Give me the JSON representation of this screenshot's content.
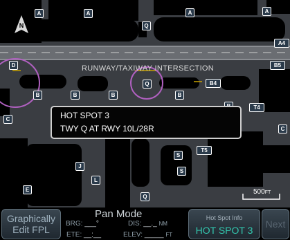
{
  "map": {
    "north_label": "N",
    "intersection_label": "RUNWAY/TAXIWAY INTERSECTION",
    "taxiway_labels": [
      "A",
      "B",
      "C",
      "D",
      "E",
      "J",
      "L",
      "Q",
      "S",
      "T4",
      "T5",
      "B4",
      "B5",
      "A4"
    ],
    "scale": {
      "value": "500",
      "unit": "FT"
    }
  },
  "popup": {
    "title": "HOT SPOT 3",
    "detail": "TWY Q AT RWY 10L/28R"
  },
  "toolbar": {
    "edit_fpl_line1": "Graphically",
    "edit_fpl_line2": "Edit FPL",
    "pan_mode_title": "Pan Mode",
    "brg_label": "BRG:",
    "brg_value": "___°",
    "dis_label": "DIS:",
    "dis_value": "__._",
    "dis_unit": "NM",
    "ete_label": "ETE:",
    "ete_value": "__:__",
    "elev_label": "ELEV:",
    "elev_value": "_____",
    "elev_unit": "FT",
    "hot_spot_info_caption": "Hot Spot Info",
    "hot_spot_info_value": "HOT SPOT 3",
    "next_label": "Next"
  },
  "colors": {
    "hotspot_circle": "#b060c0",
    "accent_teal": "#33c9b0",
    "taxiway": "#3c3f44",
    "runway": "#6a6d72",
    "buildings": "#000000"
  }
}
